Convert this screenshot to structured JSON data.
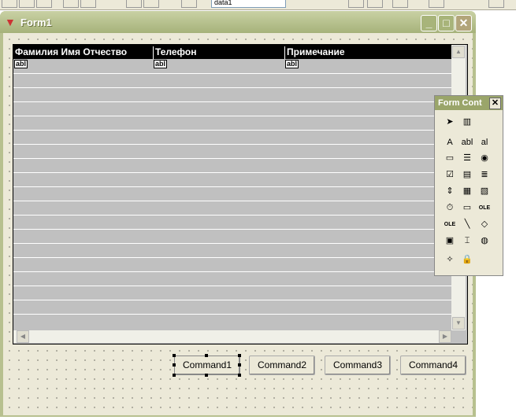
{
  "toolbar": {
    "datasource_combo": "data1"
  },
  "window": {
    "title": "Form1",
    "icon": "fox-icon",
    "minimize": "_",
    "maximize": "□",
    "close": "✕"
  },
  "grid": {
    "columns": [
      {
        "header": "Фамилия Имя Отчество",
        "cell": "abl"
      },
      {
        "header": "Телефон",
        "cell": "abl"
      },
      {
        "header": "Примечание",
        "cell": "abl"
      }
    ]
  },
  "buttons": [
    "Command1",
    "Command2",
    "Command3",
    "Command4"
  ],
  "form_controls": {
    "title": "Form Cont",
    "close": "✕",
    "tools": [
      {
        "name": "pointer",
        "g": "➤"
      },
      {
        "name": "view-classes",
        "g": "▥"
      },
      {
        "name": "label",
        "g": "A"
      },
      {
        "name": "textbox",
        "g": "abl"
      },
      {
        "name": "editbox",
        "g": "al"
      },
      {
        "name": "command-button",
        "g": "▭"
      },
      {
        "name": "command-group",
        "g": "☰"
      },
      {
        "name": "option-group",
        "g": "◉"
      },
      {
        "name": "checkbox",
        "g": "☑"
      },
      {
        "name": "combobox",
        "g": "▤"
      },
      {
        "name": "listbox",
        "g": "≣"
      },
      {
        "name": "spinner",
        "g": "⇕"
      },
      {
        "name": "grid",
        "g": "▦"
      },
      {
        "name": "image",
        "g": "▧"
      },
      {
        "name": "timer",
        "g": "⏱"
      },
      {
        "name": "pageframe",
        "g": "▭"
      },
      {
        "name": "ole-container",
        "g": "OLE"
      },
      {
        "name": "ole-bound",
        "g": "OLE"
      },
      {
        "name": "line",
        "g": "╲"
      },
      {
        "name": "shape",
        "g": "◇"
      },
      {
        "name": "container",
        "g": "▣"
      },
      {
        "name": "separator",
        "g": "⌶"
      },
      {
        "name": "hyperlink",
        "g": "◍"
      },
      {
        "name": "builder-lock",
        "g": "✧"
      },
      {
        "name": "button-lock",
        "g": "🔒"
      }
    ]
  }
}
